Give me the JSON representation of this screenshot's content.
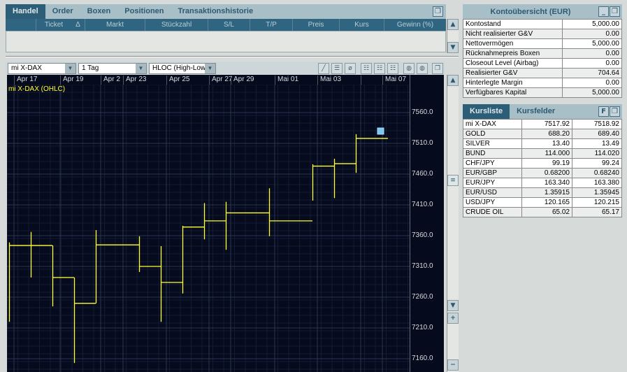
{
  "trade_panel": {
    "tabs": [
      {
        "label": "Handel",
        "active": true
      },
      {
        "label": "Order"
      },
      {
        "label": "Boxen"
      },
      {
        "label": "Positionen"
      },
      {
        "label": "Transaktionshistorie"
      }
    ],
    "columns": [
      "",
      "Ticket",
      "Δ",
      "Markt",
      "Stückzahl",
      "S/L",
      "T/P",
      "Preis",
      "Kurs",
      "Gewinn (%)"
    ],
    "restore_icon": "restore-window-icon"
  },
  "chart_panel": {
    "instrument": "mi X-DAX",
    "interval": "1 Tag",
    "chart_type": "HLOC (High-Low",
    "series_label": "mi X-DAX (OHLC)",
    "tools": [
      "line-tool-icon",
      "horizontal-line-icon",
      "no-draw-icon",
      "grid-style-1-icon",
      "grid-style-2-icon",
      "grid-style-3-icon",
      "zoom-in-icon",
      "zoom-out-icon",
      "restore-window-icon"
    ],
    "date_labels": [
      "Apr 17",
      "Apr 19",
      "Apr 2",
      "Apr 23",
      "Apr 25",
      "Apr 27",
      "Apr 29",
      "Mai 01",
      "Mai 03",
      "",
      "Mai 07"
    ]
  },
  "chart_data": {
    "type": "ohlc",
    "title": "mi X-DAX (OHLC)",
    "y_ticks": [
      "7560.0",
      "7510.0",
      "7460.0",
      "7410.0",
      "7360.0",
      "7310.0",
      "7260.0",
      "7210.0",
      "7160.0"
    ],
    "ylim": [
      7140,
      7620
    ],
    "line_color": "#ffff33",
    "marker_color": "#7ec8f0",
    "bars": [
      {
        "high": 7349,
        "low": 7220,
        "close": 7344
      },
      {
        "high": 7366,
        "low": 7292,
        "close": 7344
      },
      {
        "high": 7344,
        "low": 7245,
        "close": 7292
      },
      {
        "high": 7292,
        "low": 7153,
        "close": 7250
      },
      {
        "high": 7369,
        "low": 7250,
        "close": 7345
      },
      {
        "high": 7359,
        "low": 7301,
        "close": 7310
      },
      {
        "high": 7343,
        "low": 7220,
        "close": 7284
      },
      {
        "high": 7376,
        "low": 7266,
        "close": 7374
      },
      {
        "high": 7413,
        "low": 7354,
        "close": 7384
      },
      {
        "high": 7415,
        "low": 7337,
        "close": 7397
      },
      {
        "high": 7437,
        "low": 7359,
        "close": 7384
      },
      {
        "high": 7476,
        "low": 7417,
        "close": 7473
      },
      {
        "high": 7485,
        "low": 7421,
        "close": 7477
      },
      {
        "high": 7525,
        "low": 7462,
        "close": 7518
      }
    ]
  },
  "account": {
    "title": "Kontoübersicht (EUR)",
    "rows": [
      {
        "label": "Kontostand",
        "value": "5,000.00"
      },
      {
        "label": "Nicht realisierter G&V",
        "value": "0.00"
      },
      {
        "label": "Nettovermögen",
        "value": "5,000.00"
      },
      {
        "label": "Rücknahmepreis Boxen",
        "value": "0.00"
      },
      {
        "label": "Closeout Level (Airbag)",
        "value": "0.00"
      },
      {
        "label": "Realisierter G&V",
        "value": "704.64"
      },
      {
        "label": "Hinterlegte Margin",
        "value": "0.00"
      },
      {
        "label": "Verfügbares Kapital",
        "value": "5,000.00"
      }
    ]
  },
  "quotes": {
    "tabs": [
      {
        "label": "Kursliste",
        "active": true
      },
      {
        "label": "Kursfelder"
      }
    ],
    "f_button": "F",
    "rows": [
      {
        "name": "mi X-DAX",
        "bid": "7517.92",
        "ask": "7518.92"
      },
      {
        "name": "GOLD",
        "bid": "688.20",
        "ask": "689.40"
      },
      {
        "name": "SILVER",
        "bid": "13.40",
        "ask": "13.49"
      },
      {
        "name": "BUND",
        "bid": "114.000",
        "ask": "114.020"
      },
      {
        "name": "CHF/JPY",
        "bid": "99.19",
        "ask": "99.24"
      },
      {
        "name": "EUR/GBP",
        "bid": "0.68200",
        "ask": "0.68240"
      },
      {
        "name": "EUR/JPY",
        "bid": "163.340",
        "ask": "163.380"
      },
      {
        "name": "EUR/USD",
        "bid": "1.35915",
        "ask": "1.35945"
      },
      {
        "name": "USD/JPY",
        "bid": "120.165",
        "ask": "120.215"
      },
      {
        "name": "CRUDE OIL",
        "bid": "65.02",
        "ask": "65.17"
      }
    ]
  }
}
